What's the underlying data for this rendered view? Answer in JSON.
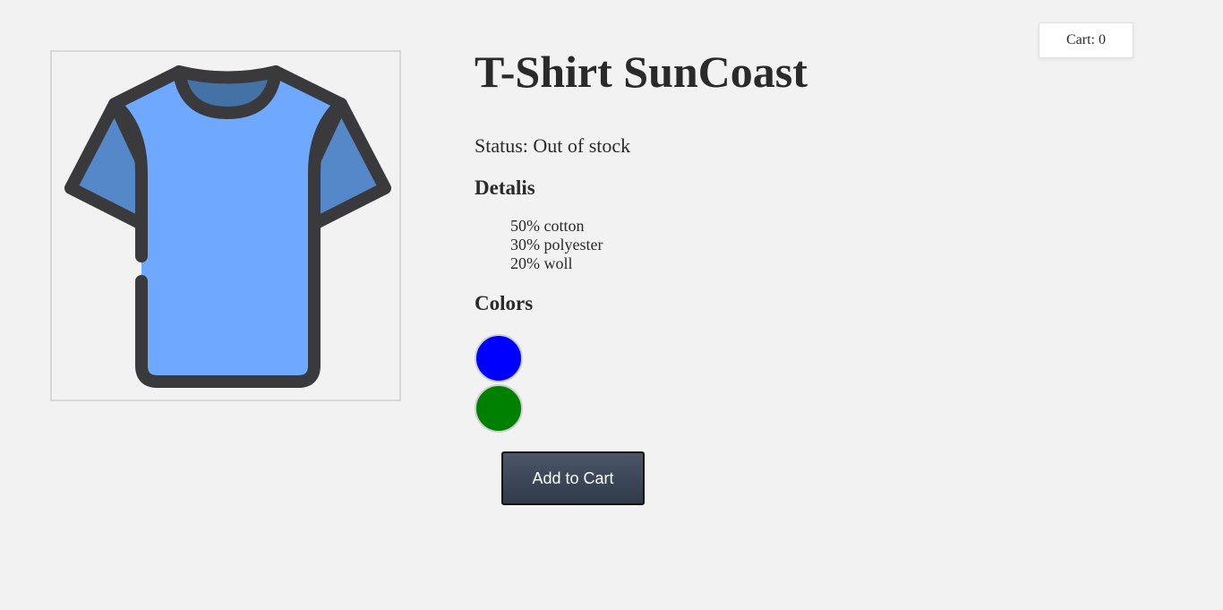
{
  "product": {
    "title": "T-Shirt SunCoast",
    "status": "Status: Out of stock",
    "image_icon": "t-shirt-icon"
  },
  "details": {
    "heading": "Detalis",
    "items": [
      "50% cotton",
      "30% polyester",
      "20% woll"
    ]
  },
  "colors": {
    "heading": "Colors",
    "swatches": [
      "#0000ff",
      "#008000"
    ]
  },
  "actions": {
    "add_to_cart_label": "Add to Cart"
  },
  "cart": {
    "label": "Cart: 0"
  }
}
